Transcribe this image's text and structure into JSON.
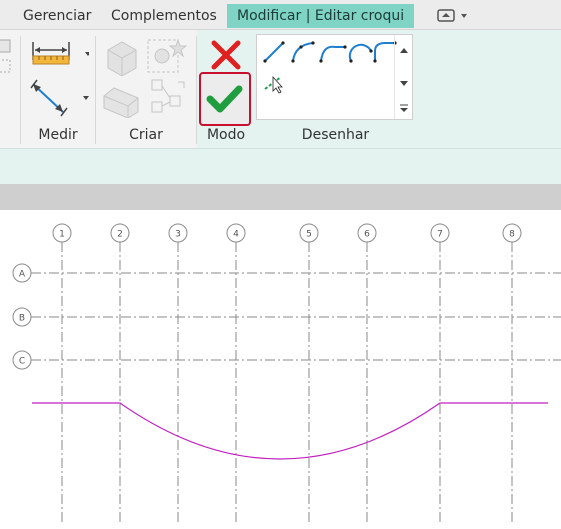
{
  "tabs": [
    {
      "label": "Gerenciar"
    },
    {
      "label": "Complementos"
    },
    {
      "label": "Modificar | Editar croqui"
    }
  ],
  "ribbon": {
    "panels": [
      {
        "label": "Medir"
      },
      {
        "label": "Criar"
      },
      {
        "label": "Modo"
      },
      {
        "label": "Desenhar"
      }
    ]
  },
  "drawing": {
    "grid_columns": [
      "1",
      "2",
      "3",
      "4",
      "5",
      "6",
      "7",
      "8"
    ],
    "grid_rows": [
      "A",
      "B",
      "C"
    ],
    "sketch_color": "#c020c0",
    "grid_line_color": "#8a8a8a"
  },
  "colors": {
    "active_tab": "#7fd4c6",
    "context_panel": "#e4f3f0",
    "finish_highlight": "#c8102e",
    "cancel_red": "#e0201f",
    "finish_green": "#1f9d3f"
  },
  "icons": {
    "cancel": "x-icon",
    "finish": "check-icon"
  }
}
